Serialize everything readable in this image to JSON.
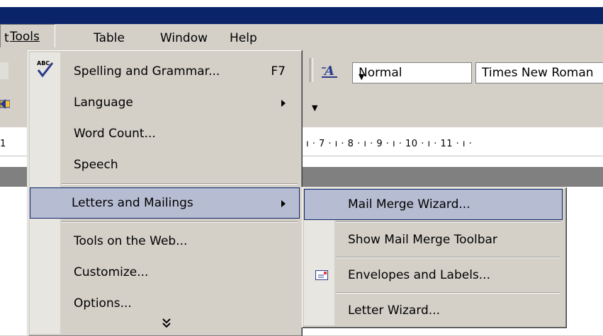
{
  "menubar": {
    "items": [
      {
        "label": "t"
      },
      {
        "label": "Tools"
      },
      {
        "label": "Table"
      },
      {
        "label": "Window"
      },
      {
        "label": "Help"
      }
    ]
  },
  "toolbar": {
    "style_value": "Normal",
    "font_value": "Times New Roman"
  },
  "ruler": {
    "left_number": "1",
    "numbers": "ı · 7 · ı · 8 · ı · 9 · ı · 10 · ı · 11 · ı ·"
  },
  "tools_menu": {
    "items": [
      {
        "label": "Spelling and Grammar...",
        "shortcut": "F7"
      },
      {
        "label": "Language"
      },
      {
        "label": "Word Count..."
      },
      {
        "label": "Speech"
      },
      {
        "label": "Letters and Mailings"
      },
      {
        "label": "Tools on the Web..."
      },
      {
        "label": "Customize..."
      },
      {
        "label": "Options..."
      }
    ],
    "expand_glyph": "¥"
  },
  "submenu": {
    "items": [
      {
        "label": "Mail Merge Wizard..."
      },
      {
        "label": "Show Mail Merge Toolbar"
      },
      {
        "label": "Envelopes and Labels..."
      },
      {
        "label": "Letter Wizard..."
      }
    ]
  },
  "colors": {
    "titlebar": "#0a246a",
    "highlight": "#b6bdd2",
    "face": "#d4d0c8"
  }
}
